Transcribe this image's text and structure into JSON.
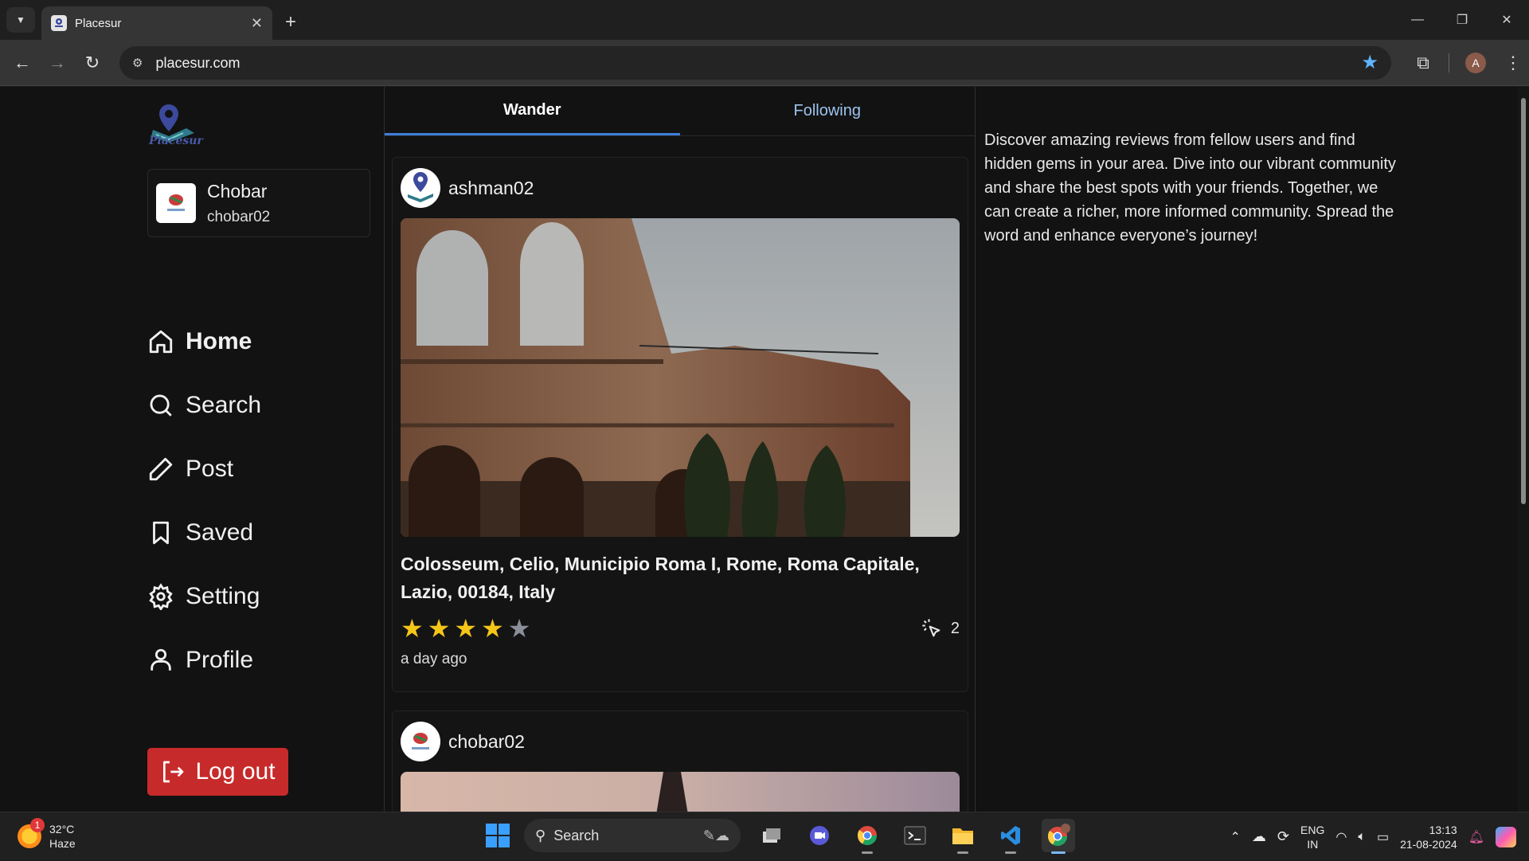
{
  "browser": {
    "tab_title": "Placesur",
    "url": "placesur.com",
    "profile_initial": "A"
  },
  "app": {
    "logo_text": "Placesur",
    "user": {
      "name": "Chobar",
      "handle": "chobar02"
    },
    "nav": [
      {
        "label": "Home",
        "icon": "home-icon",
        "active": true
      },
      {
        "label": "Search",
        "icon": "search-icon"
      },
      {
        "label": "Post",
        "icon": "pencil-icon"
      },
      {
        "label": "Saved",
        "icon": "bookmark-icon"
      },
      {
        "label": "Setting",
        "icon": "gear-icon"
      },
      {
        "label": "Profile",
        "icon": "person-icon"
      }
    ],
    "logout_label": "Log out"
  },
  "feed": {
    "tabs": [
      "Wander",
      "Following"
    ],
    "active_tab": "Wander",
    "posts": [
      {
        "user": "ashman02",
        "place": "Colosseum, Celio, Municipio Roma I, Rome, Roma Capitale, Lazio, 00184, Italy",
        "rating": 4,
        "rating_max": 5,
        "likes": "2",
        "time": "a day ago"
      },
      {
        "user": "chobar02"
      }
    ]
  },
  "sidebar_right": {
    "text": "Discover amazing reviews from fellow users and find hidden gems in your area. Dive into our vibrant community and share the best spots with your friends. Together, we can create a richer, more informed community. Spread the word and enhance everyone’s journey!"
  },
  "taskbar": {
    "weather_temp": "32°C",
    "weather_desc": "Haze",
    "weather_badge": "1",
    "search_label": "Search",
    "lang_top": "ENG",
    "lang_bottom": "IN",
    "time": "13:13",
    "date": "21-08-2024"
  },
  "colors": {
    "accent_tab": "#3e7ed8",
    "logout": "#c72a2a",
    "star_filled": "#f5c518",
    "star_empty": "#8a8f99"
  }
}
